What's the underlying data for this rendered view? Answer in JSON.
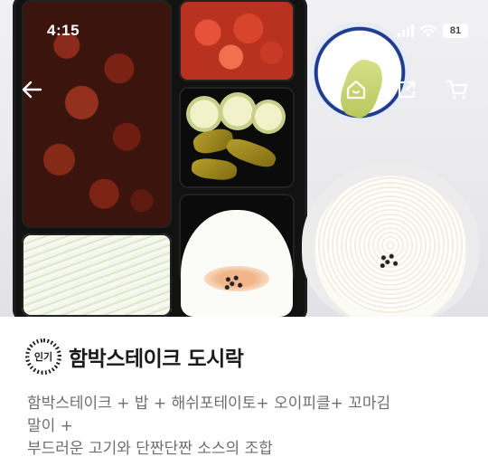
{
  "status_bar": {
    "time": "4:15",
    "battery": "81",
    "icons": [
      "signal-icon",
      "wifi-icon",
      "battery-icon"
    ]
  },
  "nav": {
    "icons": [
      "back-arrow-icon",
      "home-icon",
      "share-icon",
      "cart-icon"
    ]
  },
  "product": {
    "badge": "인기",
    "name": "함박스테이크 도시락",
    "description_lines": [
      "함박스테이크 + 밥 + 해쉬포테이토+ 오이피클+ 꼬마김",
      "말이 +",
      "부드러운 고기와 단짠단짠 소스의 조합"
    ]
  },
  "colors": {
    "overlay_icon": "#ffffff",
    "title": "#1a1a1a",
    "description": "#6e6e6e"
  }
}
